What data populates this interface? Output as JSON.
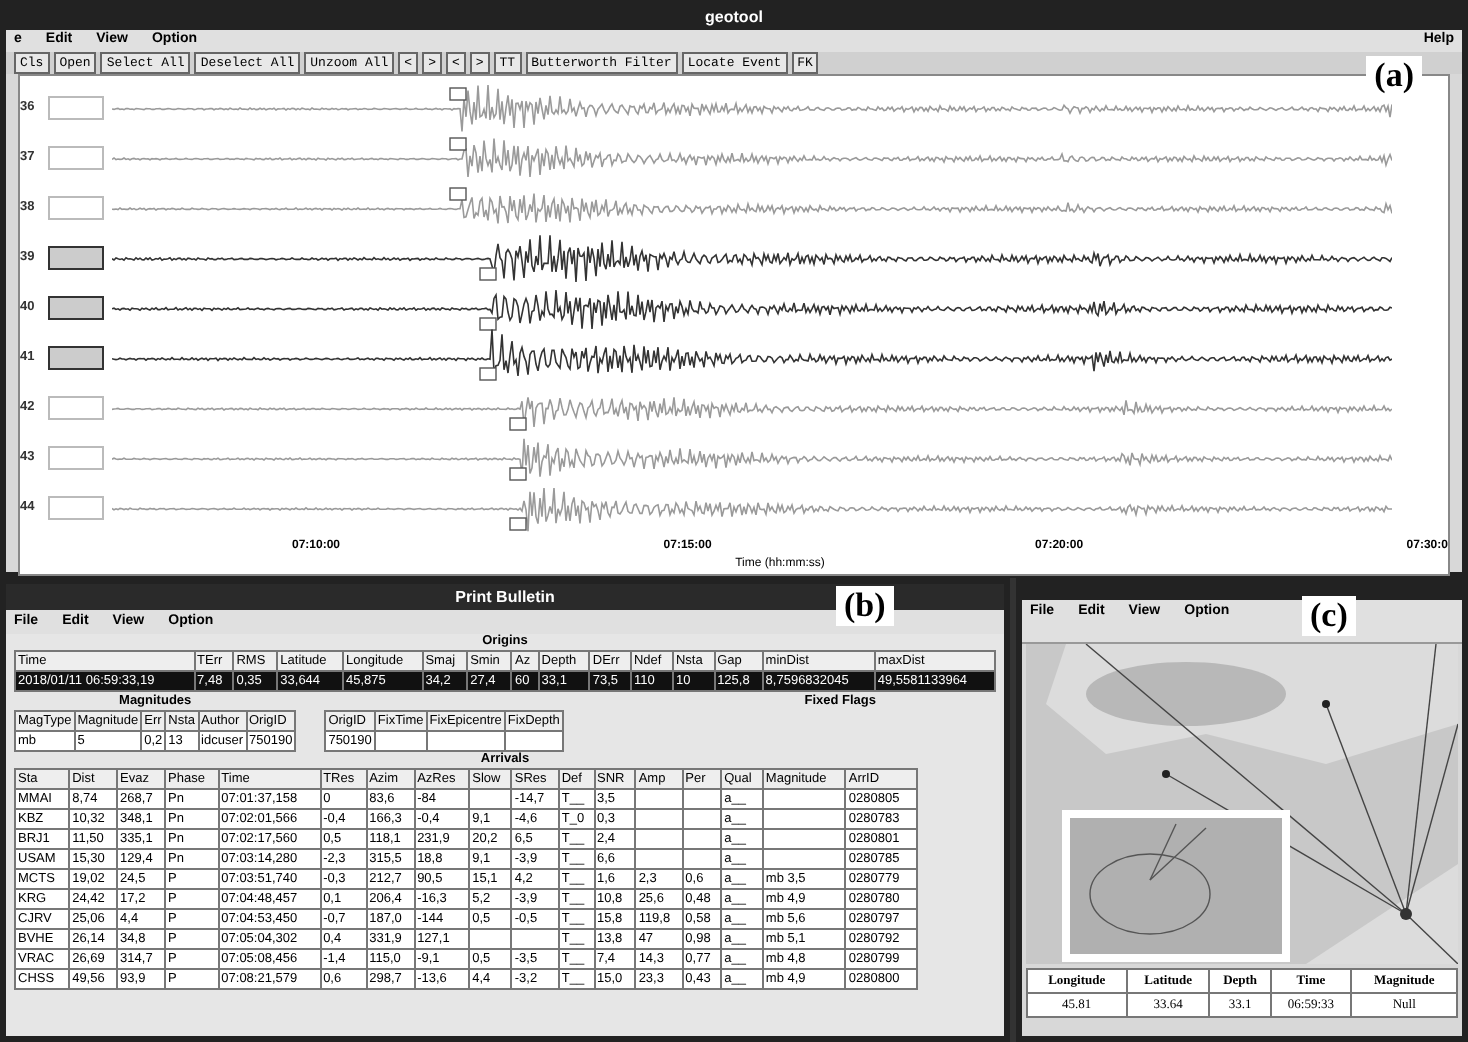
{
  "geotool": {
    "title": "geotool",
    "menu": [
      "e",
      "Edit",
      "View",
      "Option"
    ],
    "help": "Help",
    "toolbar": [
      "Cls",
      "Open",
      "Select All",
      "Deselect All",
      "Unzoom All",
      "<",
      ">",
      "<",
      ">",
      "TT",
      "Butterworth Filter",
      "Locate Event",
      "FK"
    ],
    "panel_label": "(a)",
    "channels": [
      {
        "number": "36",
        "selected": false
      },
      {
        "number": "37",
        "selected": false
      },
      {
        "number": "38",
        "selected": false
      },
      {
        "number": "39",
        "selected": true
      },
      {
        "number": "40",
        "selected": true
      },
      {
        "number": "41",
        "selected": true
      },
      {
        "number": "42",
        "selected": false
      },
      {
        "number": "43",
        "selected": false
      },
      {
        "number": "44",
        "selected": false
      }
    ],
    "time_ticks": [
      "07:10:00",
      "07:15:00",
      "07:20:00",
      "07:30:0"
    ],
    "time_label": "Time (hh:mm:ss)"
  },
  "bulletin": {
    "title": "Print Bulletin",
    "menu": [
      "File",
      "Edit",
      "View",
      "Option"
    ],
    "panel_label": "(b)",
    "origins": {
      "heading": "Origins",
      "columns": [
        "Time",
        "TErr",
        "RMS",
        "Latitude",
        "Longitude",
        "Smaj",
        "Smin",
        "Az",
        "Depth",
        "DErr",
        "Ndef",
        "Nsta",
        "Gap",
        "minDist",
        "maxDist"
      ],
      "rows": [
        {
          "selected": true,
          "cells": [
            "2018/01/11 06:59:33,19",
            "7,48",
            "0,35",
            "33,644",
            "45,875",
            "34,2",
            "27,4",
            "60",
            "33,1",
            "73,5",
            "110",
            "10",
            "125,8",
            "8,7596832045",
            "49,5581133964"
          ]
        }
      ]
    },
    "magnitudes": {
      "heading": "Magnitudes",
      "columns": [
        "MagType",
        "Magnitude",
        "Err",
        "Nsta",
        "Author",
        "OrigID"
      ],
      "rows": [
        [
          "mb",
          "5",
          "0,2",
          "13",
          "idcuser",
          "750190"
        ]
      ]
    },
    "fixed_flags": {
      "heading": "Fixed Flags",
      "columns": [
        "OrigID",
        "FixTime",
        "FixEpicentre",
        "FixDepth"
      ],
      "rows": [
        [
          "750190",
          "",
          "",
          ""
        ]
      ]
    },
    "arrivals": {
      "heading": "Arrivals",
      "columns": [
        "Sta",
        "Dist",
        "Evaz",
        "Phase",
        "Time",
        "TRes",
        "Azim",
        "AzRes",
        "Slow",
        "SRes",
        "Def",
        "SNR",
        "Amp",
        "Per",
        "Qual",
        "Magnitude",
        "ArrID"
      ],
      "rows": [
        [
          "MMAI",
          "8,74",
          "268,7",
          "Pn",
          "07:01:37,158",
          "0",
          "83,6",
          "-84",
          "",
          "-14,7",
          "T__",
          "3,5",
          "",
          "",
          "a__",
          "",
          "0280805"
        ],
        [
          "KBZ",
          "10,32",
          "348,1",
          "Pn",
          "07:02:01,566",
          "-0,4",
          "166,3",
          "-0,4",
          "9,1",
          "-4,6",
          "T_0",
          "0,3",
          "",
          "",
          "a__",
          "",
          "0280783"
        ],
        [
          "BRJ1",
          "11,50",
          "335,1",
          "Pn",
          "07:02:17,560",
          "0,5",
          "118,1",
          "231,9",
          "20,2",
          "6,5",
          "T__",
          "2,4",
          "",
          "",
          "a__",
          "",
          "0280801"
        ],
        [
          "USAM",
          "15,30",
          "129,4",
          "Pn",
          "07:03:14,280",
          "-2,3",
          "315,5",
          "18,8",
          "9,1",
          "-3,9",
          "T__",
          "6,6",
          "",
          "",
          "a__",
          "",
          "0280785"
        ],
        [
          "MCTS",
          "19,02",
          "24,5",
          "P",
          "07:03:51,740",
          "-0,3",
          "212,7",
          "90,5",
          "15,1",
          "4,2",
          "T__",
          "1,6",
          "2,3",
          "0,6",
          "a__",
          "mb 3,5",
          "0280779"
        ],
        [
          "KRG",
          "24,42",
          "17,2",
          "P",
          "07:04:48,457",
          "0,1",
          "206,4",
          "-16,3",
          "5,2",
          "-3,9",
          "T__",
          "10,8",
          "25,6",
          "0,48",
          "a__",
          "mb 4,9",
          "0280780"
        ],
        [
          "CJRV",
          "25,06",
          "4,4",
          "P",
          "07:04:53,450",
          "-0,7",
          "187,0",
          "-144",
          "0,5",
          "-0,5",
          "T__",
          "15,8",
          "119,8",
          "0,58",
          "a__",
          "mb 5,6",
          "0280797"
        ],
        [
          "BVHE",
          "26,14",
          "34,8",
          "P",
          "07:05:04,302",
          "0,4",
          "331,9",
          "127,1",
          "",
          "",
          "T__",
          "13,8",
          "47",
          "0,98",
          "a__",
          "mb 5,1",
          "0280792"
        ],
        [
          "VRAC",
          "26,69",
          "314,7",
          "P",
          "07:05:08,456",
          "-1,4",
          "115,0",
          "-9,1",
          "0,5",
          "-3,5",
          "T__",
          "7,4",
          "14,3",
          "0,77",
          "a__",
          "mb 4,8",
          "0280799"
        ],
        [
          "CHSS",
          "49,56",
          "93,9",
          "P",
          "07:08:21,579",
          "0,6",
          "298,7",
          "-13,6",
          "4,4",
          "-3,2",
          "T__",
          "15,0",
          "23,3",
          "0,43",
          "a__",
          "mb 4,9",
          "0280800"
        ]
      ]
    }
  },
  "map_window": {
    "menu": [
      "File",
      "Edit",
      "View",
      "Option"
    ],
    "panel_label": "(c)",
    "summary": {
      "columns": [
        "Longitude",
        "Latitude",
        "Depth",
        "Time",
        "Magnitude"
      ],
      "values": [
        "45.81",
        "33.64",
        "33.1",
        "06:59:33",
        "Null"
      ]
    }
  }
}
